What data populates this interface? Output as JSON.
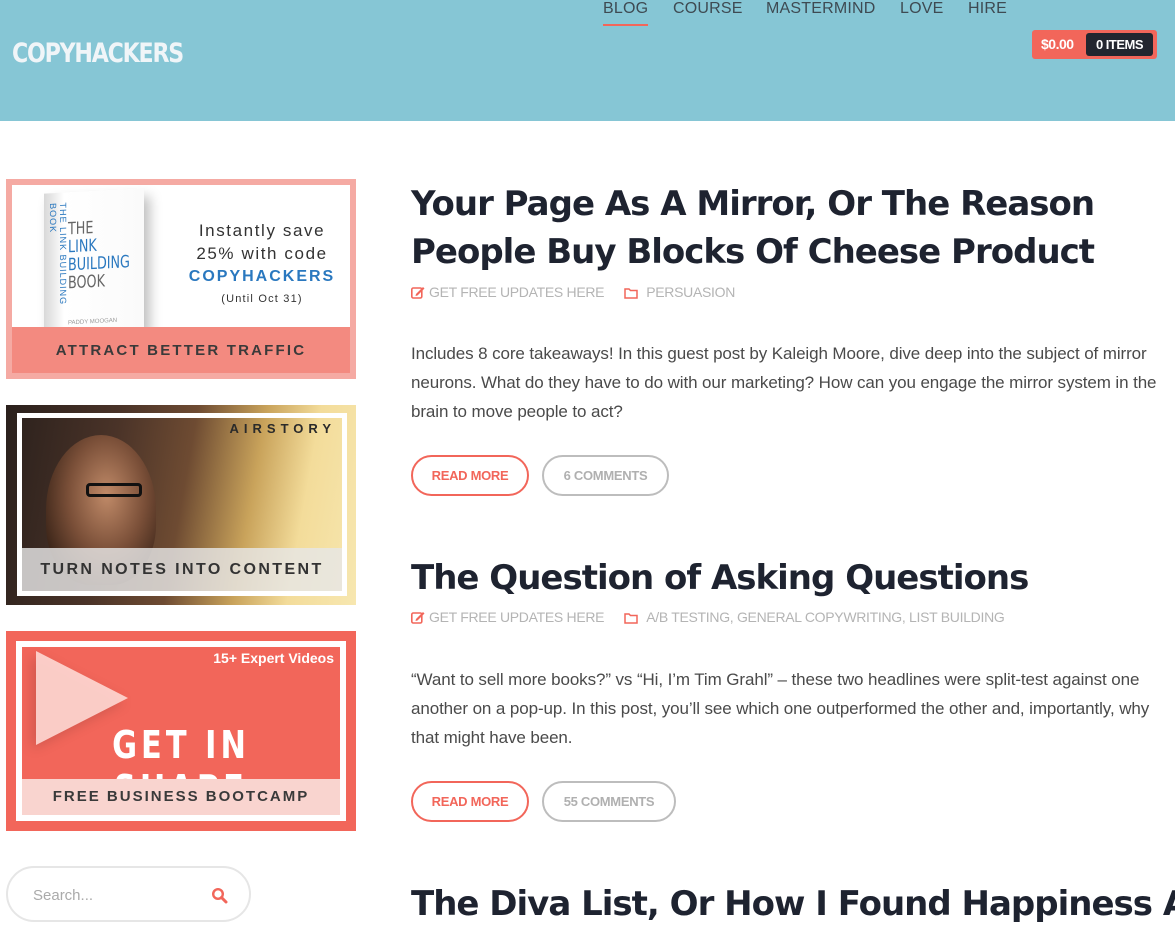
{
  "header": {
    "logo": "COPYHACKERS",
    "nav": [
      {
        "label": "BLOG",
        "active": true
      },
      {
        "label": "COURSE",
        "active": false
      },
      {
        "label": "MASTERMIND",
        "active": false
      },
      {
        "label": "LOVE",
        "active": false
      },
      {
        "label": "HIRE",
        "active": false
      }
    ],
    "cart": {
      "total": "$0.00",
      "items": "0 ITEMS"
    },
    "colors": {
      "header_bg": "#86c6d5",
      "accent": "#f2665a",
      "nav_text": "#3e4a52"
    }
  },
  "sidebar": {
    "ads": [
      {
        "book_title_lines": [
          "THE",
          "LINK",
          "BUILDING",
          "BOOK"
        ],
        "book_spine": "THE LINK BUILDING BOOK",
        "book_author": "PADDY MOOGAN",
        "promo_line1": "Instantly save",
        "promo_line2": "25% with code",
        "promo_code": "COPYHACKERS",
        "promo_until": "(Until Oct 31)",
        "band": "ATTRACT BETTER TRAFFIC"
      },
      {
        "brand": "AIRSTORY",
        "band": "TURN NOTES INTO CONTENT"
      },
      {
        "badge": "15+ Expert Videos",
        "headline": "GET IN SHAPE",
        "band": "FREE BUSINESS BOOTCAMP"
      }
    ],
    "search": {
      "placeholder": "Search...",
      "value": ""
    }
  },
  "posts": [
    {
      "title": "Your Page As A Mirror, Or The Reason People Buy Blocks Of Cheese Product",
      "meta_link": "GET FREE UPDATES HERE",
      "categories": "PERSUASION",
      "excerpt": "Includes 8 core takeaways! In this guest post by Kaleigh Moore, dive deep into the subject of mirror neurons. What do they have to do with our marketing? How can you engage the mirror system in the brain to move people to act?",
      "read_more": "READ MORE",
      "comments": "6 COMMENTS"
    },
    {
      "title": "The Question of Asking Questions",
      "meta_link": "GET FREE UPDATES HERE",
      "categories": "A/B TESTING, GENERAL COPYWRITING, LIST BUILDING",
      "excerpt": "“Want to sell more books?” vs “Hi, I’m Tim Grahl” – these two headlines were split-test against one another on a pop-up. In this post, you’ll see which one outperformed the other and, importantly, why that might have been.",
      "read_more": "READ MORE",
      "comments": "55 COMMENTS"
    },
    {
      "title": "The Diva List, Or How I Found Happiness As A"
    }
  ]
}
